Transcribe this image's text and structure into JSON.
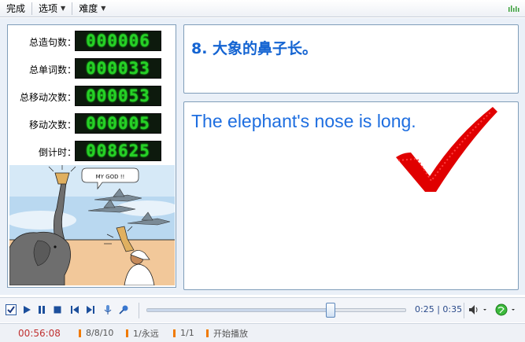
{
  "menubar": {
    "items": [
      {
        "label": "完成",
        "has_dropdown": false
      },
      {
        "label": "选项",
        "has_dropdown": true
      },
      {
        "label": "难度",
        "has_dropdown": true
      }
    ],
    "grip_icon": "grip-icon"
  },
  "stats": [
    {
      "label": "总造句数：",
      "value": "000006"
    },
    {
      "label": "总单词数：",
      "value": "000033"
    },
    {
      "label": "总移动次数：",
      "value": "000053"
    },
    {
      "label": "移动次数：",
      "value": "000005"
    },
    {
      "label": "倒计时：",
      "value": "008625"
    }
  ],
  "cartoon": {
    "speech_bubble": "MY GOD !!"
  },
  "exercise": {
    "chinese_sentence": "8.  大象的鼻子长。",
    "english_sentence": "The elephant's nose is long.",
    "result_icon": "checkmark-icon",
    "result_color": "#e00000"
  },
  "player": {
    "progress": 0.71,
    "time_display": "0:25 | 0:35",
    "buttons": [
      "checkbox-icon",
      "play-icon",
      "pause-icon",
      "stop-icon",
      "previous-icon",
      "next-icon",
      "microphone-icon",
      "pin-icon",
      "volume-icon",
      "globe-icon"
    ]
  },
  "status": {
    "clock": "00:56:08",
    "progress_count": "8/8/10",
    "repeat": "1/永远",
    "page": "1/1",
    "state": "开始播放"
  },
  "colors": {
    "lcd_text": "#27d027",
    "sentence_blue": "#1464d2",
    "accent_orange": "#f07a00"
  }
}
